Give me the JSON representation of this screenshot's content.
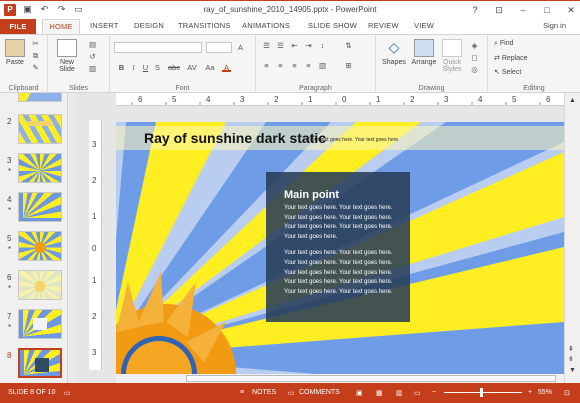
{
  "window": {
    "document_title": "ray_of_sunshine_2010_14905.pptx - PowerPoint",
    "app_icon": "P",
    "controls": [
      "?",
      "⊡",
      "–",
      "□",
      "✕"
    ]
  },
  "quick_access": [
    "save-icon",
    "undo-icon",
    "redo-icon",
    "present-icon"
  ],
  "tabs": [
    "FILE",
    "HOME",
    "INSERT",
    "DESIGN",
    "TRANSITIONS",
    "ANIMATIONS",
    "SLIDE SHOW",
    "REVIEW",
    "VIEW"
  ],
  "active_tab": "HOME",
  "sign_in": "Sign in",
  "ribbon": {
    "clipboard": {
      "label": "Clipboard",
      "paste": "Paste"
    },
    "slides": {
      "label": "Slides",
      "new_slide_1": "New",
      "new_slide_2": "Slide"
    },
    "font": {
      "label": "Font",
      "tools": [
        "B",
        "I",
        "U",
        "S",
        "abc",
        "AV",
        "Aa",
        "A"
      ]
    },
    "paragraph": {
      "label": "Paragraph"
    },
    "drawing": {
      "label": "Drawing",
      "shapes": "Shapes",
      "arrange": "Arrange",
      "quick_styles_1": "Quick",
      "quick_styles_2": "Styles"
    },
    "editing": {
      "label": "Editing",
      "find": "Find",
      "replace": "Replace",
      "select": "Select"
    }
  },
  "thumbnails": [
    {
      "num": "2",
      "star": ""
    },
    {
      "num": "3",
      "star": "*"
    },
    {
      "num": "4",
      "star": "*"
    },
    {
      "num": "5",
      "star": "*"
    },
    {
      "num": "6",
      "star": "*"
    },
    {
      "num": "7",
      "star": "*"
    },
    {
      "num": "8",
      "star": ""
    }
  ],
  "selected_slide": "8",
  "ruler_h": [
    "6",
    "5",
    "4",
    "3",
    "2",
    "1",
    "0",
    "1",
    "2",
    "3",
    "4",
    "5",
    "6"
  ],
  "ruler_v": [
    "3",
    "2",
    "1",
    "0",
    "1",
    "2",
    "3"
  ],
  "slide": {
    "title": "Ray of sunshine dark static",
    "subtitle": "Your text goes here. Your text goes here.",
    "box_heading": "Main point",
    "para1": "Your text goes here. Your text goes here. Your text goes here. Your text goes here. Your text goes here. Your text goes here. Your text goes here.",
    "para2": "Your text goes here. Your text goes here. Your text goes here. Your text goes here. Your text goes here. Your text goes here. Your text goes here. Your text goes here. Your text goes here. Your text goes here."
  },
  "status": {
    "slide_info": "SLIDE 8 OF 10",
    "notes": "NOTES",
    "comments": "COMMENTS",
    "zoom": "55%"
  },
  "colors": {
    "accent": "#c43e1c",
    "slide_yellow": "#ffee22",
    "slide_blue": "#5b8de0",
    "sun_orange": "#f29a12",
    "box_dark": "#2f4a63"
  }
}
